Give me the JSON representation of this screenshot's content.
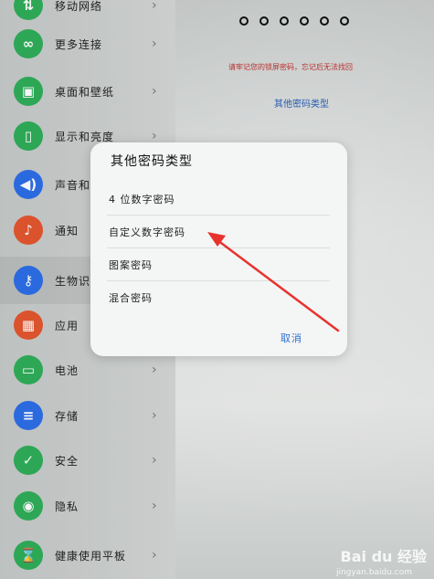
{
  "sidebar": {
    "items": [
      {
        "label": "移动网络",
        "icon": "cellular-icon",
        "color": "#2fae59"
      },
      {
        "label": "更多连接",
        "icon": "link-icon",
        "color": "#2fae59"
      },
      {
        "label": "桌面和壁纸",
        "icon": "wallpaper-icon",
        "color": "#2fae59"
      },
      {
        "label": "显示和亮度",
        "icon": "display-icon",
        "color": "#2fae59"
      },
      {
        "label": "声音和振动",
        "icon": "sound-icon",
        "color": "#2d6fe8"
      },
      {
        "label": "通知",
        "icon": "bell-icon",
        "color": "#e4572e"
      },
      {
        "label": "生物识别和密码",
        "icon": "key-icon",
        "color": "#2d6fe8"
      },
      {
        "label": "应用",
        "icon": "apps-icon",
        "color": "#e4572e"
      },
      {
        "label": "电池",
        "icon": "battery-icon",
        "color": "#2fae59"
      },
      {
        "label": "存储",
        "icon": "storage-icon",
        "color": "#2d6fe8"
      },
      {
        "label": "安全",
        "icon": "shield-icon",
        "color": "#2fae59"
      },
      {
        "label": "隐私",
        "icon": "privacy-icon",
        "color": "#2fae59"
      },
      {
        "label": "健康使用平板",
        "icon": "hourglass-icon",
        "color": "#2fae59"
      }
    ]
  },
  "pin_entry": {
    "warning": "请牢记您的锁屏密码，忘记后无法找回",
    "other_type_link": "其他密码类型"
  },
  "dialog": {
    "title": "其他密码类型",
    "options": [
      "4 位数字密码",
      "自定义数字密码",
      "图案密码",
      "混合密码"
    ],
    "cancel": "取消"
  },
  "annotation": {
    "arrow_color": "#e8322c"
  },
  "watermark": {
    "brand": "Bai du 经验",
    "site": "jingyan.baidu.com"
  }
}
